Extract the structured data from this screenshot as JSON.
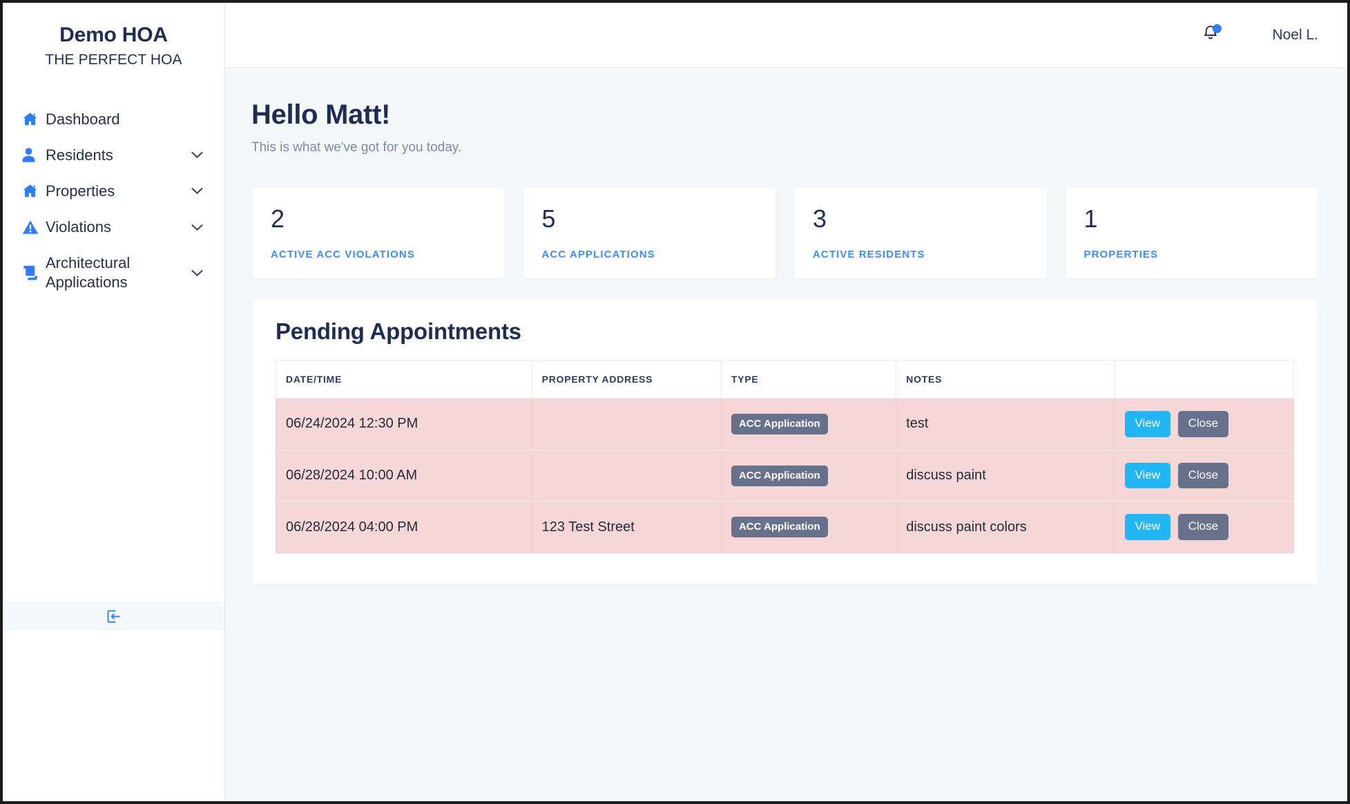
{
  "brand": {
    "title": "Demo HOA",
    "subtitle": "THE PERFECT HOA"
  },
  "sidebar": {
    "items": [
      {
        "label": "Dashboard",
        "icon": "home-icon",
        "expandable": false
      },
      {
        "label": "Residents",
        "icon": "user-icon",
        "expandable": true
      },
      {
        "label": "Properties",
        "icon": "home-icon",
        "expandable": true
      },
      {
        "label": "Violations",
        "icon": "warning-triangle-icon",
        "expandable": true
      },
      {
        "label": "Architectural Applications",
        "icon": "scroll-icon",
        "expandable": true
      }
    ],
    "logout_icon": "logout-icon"
  },
  "topbar": {
    "notification_icon": "bell-icon",
    "has_unread": true,
    "user_name": "Noel L."
  },
  "greeting": {
    "title": "Hello Matt!",
    "subtitle": "This is what we've got for you today."
  },
  "stats": [
    {
      "value": "2",
      "label": "ACTIVE ACC VIOLATIONS"
    },
    {
      "value": "5",
      "label": "ACC APPLICATIONS"
    },
    {
      "value": "3",
      "label": "ACTIVE RESIDENTS"
    },
    {
      "value": "1",
      "label": "PROPERTIES"
    }
  ],
  "appointments": {
    "title": "Pending Appointments",
    "columns": [
      "DATE/TIME",
      "PROPERTY ADDRESS",
      "TYPE",
      "NOTES",
      ""
    ],
    "rows": [
      {
        "datetime": "06/24/2024 12:30 PM",
        "address": "",
        "type": "ACC Application",
        "notes": "test",
        "view_label": "View",
        "close_label": "Close"
      },
      {
        "datetime": "06/28/2024 10:00 AM",
        "address": "",
        "type": "ACC Application",
        "notes": "discuss paint",
        "view_label": "View",
        "close_label": "Close"
      },
      {
        "datetime": "06/28/2024 04:00 PM",
        "address": "123 Test Street",
        "type": "ACC Application",
        "notes": "discuss paint colors",
        "view_label": "View",
        "close_label": "Close"
      }
    ]
  },
  "colors": {
    "accent_blue": "#3d8bfd",
    "brand_navy": "#1f2d52",
    "row_pink": "#f6d7d8",
    "badge_slate": "#68718c",
    "view_button": "#22b6f4",
    "page_background": "#f5f8fb"
  }
}
